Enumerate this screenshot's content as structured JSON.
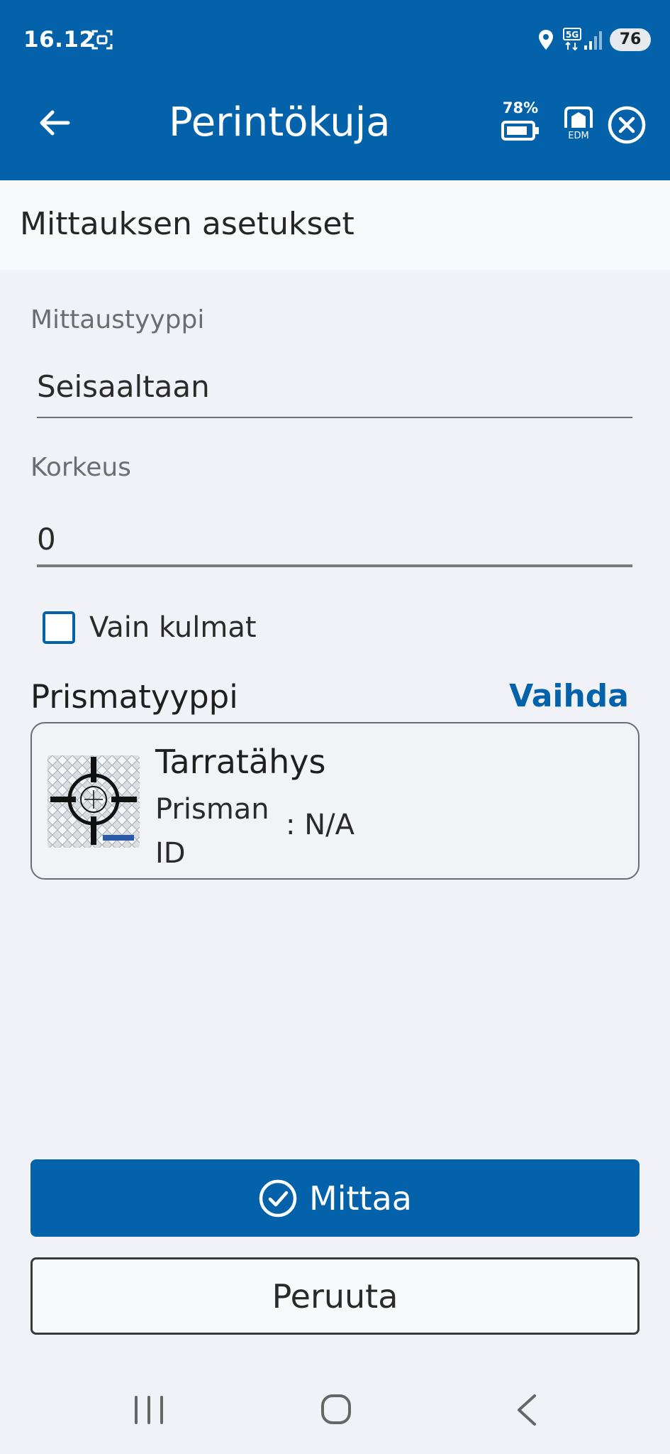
{
  "status_bar": {
    "time": "16.12",
    "battery": "76",
    "icons": [
      "screen-record-icon",
      "location-icon",
      "5g-signal-icon"
    ]
  },
  "app_bar": {
    "title": "Perintökuja",
    "device_battery": "78%",
    "edm_label": "EDM",
    "icons": [
      "back-arrow-icon",
      "device-battery-icon",
      "edm-prism-icon",
      "close-circle-icon"
    ]
  },
  "section": {
    "title": "Mittauksen asetukset"
  },
  "form": {
    "measurement_type": {
      "label": "Mittaustyyppi",
      "value": "Seisaaltaan"
    },
    "height": {
      "label": "Korkeus",
      "value": "0"
    },
    "angles_only": {
      "label": "Vain kulmat",
      "checked": false
    }
  },
  "prism": {
    "section_title": "Prismatyyppi",
    "change_label": "Vaihda",
    "name": "Tarratähys",
    "id_label": "Prisman ID",
    "id_value": ": N/A"
  },
  "actions": {
    "measure_label": "Mittaa",
    "cancel_label": "Peruuta"
  },
  "colors": {
    "primary": "#0462aa",
    "background": "#f1f2f7"
  },
  "nav_bar": [
    "recents-icon",
    "home-icon",
    "back-icon"
  ]
}
